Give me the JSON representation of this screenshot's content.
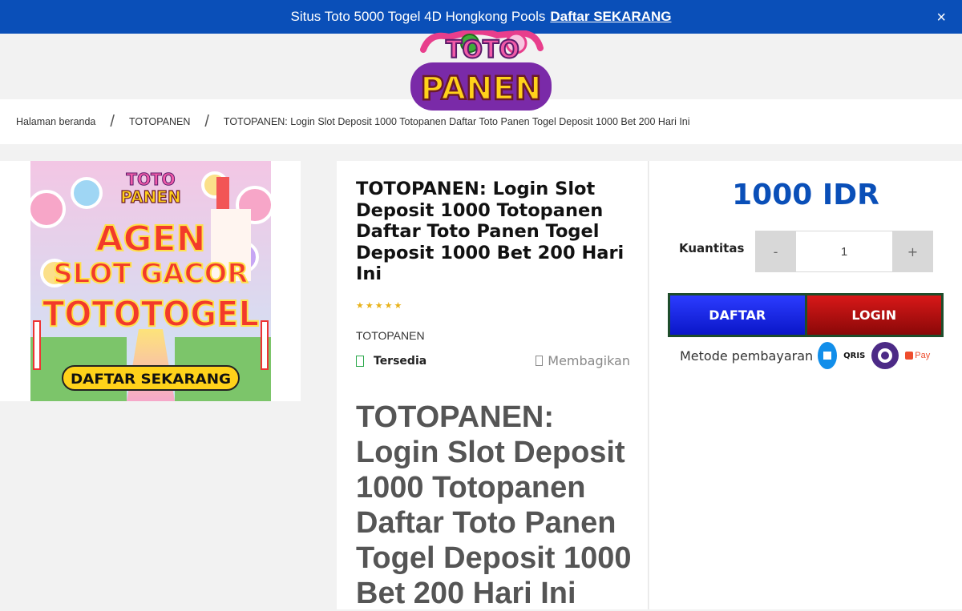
{
  "announcement": {
    "text": "Situs Toto 5000 Togel 4D Hongkong Pools",
    "cta": "Daftar SEKARANG",
    "close_glyph": "×"
  },
  "logo": {
    "line1": "TOTO",
    "line2": "PANEN"
  },
  "breadcrumb": {
    "items": [
      "Halaman beranda",
      "TOTOPANEN",
      "TOTOPANEN: Login Slot Deposit 1000 Totopanen Daftar Toto Panen Togel Deposit 1000 Bet 200 Hari Ini"
    ],
    "separator": "/"
  },
  "banner": {
    "logo_line1": "TOTO",
    "logo_line2": "PANEN",
    "line1": "AGEN",
    "line2": "SLOT GACOR",
    "line3": "TOTOTOGEL",
    "cta": "DAFTAR SEKARANG"
  },
  "product": {
    "title": "TOTOPANEN: Login Slot Deposit 1000 Totopanen Daftar Toto Panen Togel Deposit 1000 Bet 200 Hari Ini",
    "rating_glyphs": "★★★★★",
    "brand": "TOTOPANEN",
    "stock": "Tersedia",
    "share": "Membagikan",
    "description_heading": "TOTOPANEN: Login Slot Deposit 1000 Totopanen Daftar Toto Panen Togel Deposit 1000 Bet 200 Hari Ini"
  },
  "purchase": {
    "price": "1000 IDR",
    "quantity_label": "Kuantitas",
    "quantity": "1",
    "decrement": "-",
    "increment": "+",
    "register_label": "DAFTAR",
    "login_label": "LOGIN",
    "payment_label": "Metode pembayaran",
    "payment_icons": [
      "dana-icon",
      "qris-icon",
      "ovo-icon",
      "shopeepay-icon"
    ],
    "qris_text": "QRIS",
    "spay_text": "Pay"
  },
  "colors": {
    "topbar": "#0a4fb8",
    "price": "#0a4fb8",
    "register": "#1a28e8",
    "login": "#c01010",
    "stars": "#e8b21a",
    "stock_check": "#2aa84a"
  }
}
